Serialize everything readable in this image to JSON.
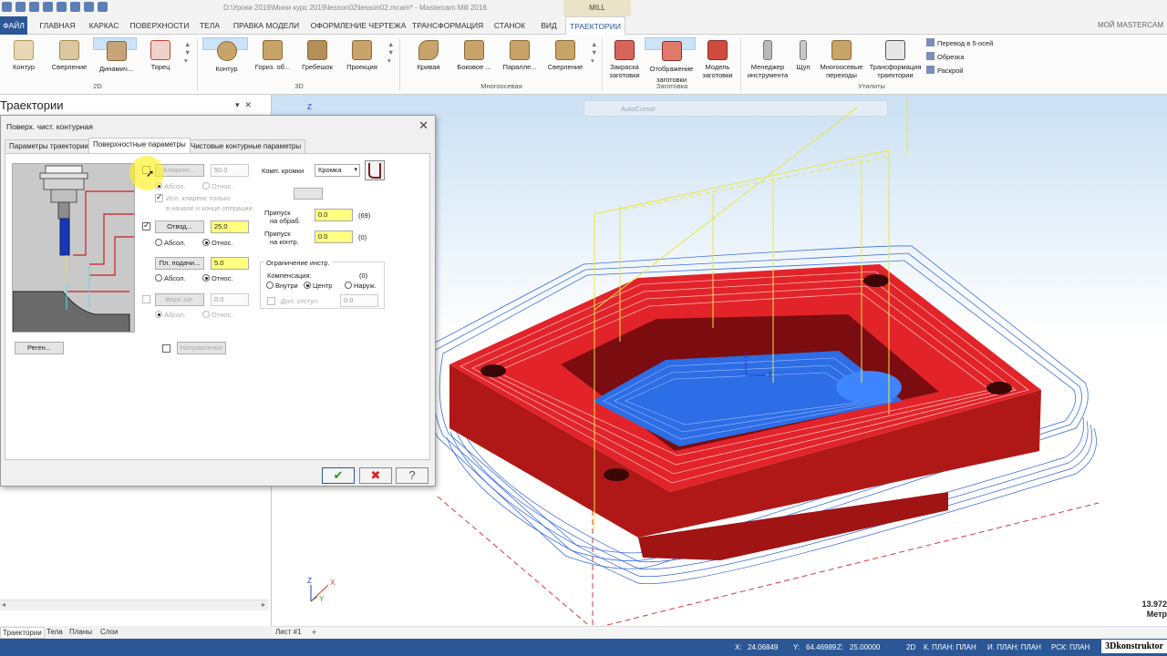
{
  "window": {
    "title": "D:\\Уроки 2019\\Мини курс 2019\\lesson02\\lesson02.mcam* - Mastercam Mill 2018",
    "context_tab": "MILL",
    "account": "МОЙ MASTERCAM"
  },
  "ribbon_tabs": [
    "ФАЙЛ",
    "ГЛАВНАЯ",
    "КАРКАС",
    "ПОВЕРХНОСТИ",
    "ТЕЛА",
    "ПРАВКА МОДЕЛИ",
    "ОФОРМЛЕНИЕ ЧЕРТЕЖА",
    "ТРАНСФОРМАЦИЯ",
    "СТАНОК",
    "ВИД",
    "ТРАЕКТОРИИ"
  ],
  "ribbon": {
    "group_2d": "2D",
    "group_3d": "3D",
    "group_multi": "Многоосевая",
    "group_stock": "Заготовка",
    "group_util": "Утилиты",
    "b2d": [
      "Контур",
      "Сверление",
      "Динамич...",
      "Торец"
    ],
    "b3d": [
      "Контур",
      "Гориз. об...",
      "Гребешок",
      "Проекция"
    ],
    "bmulti": [
      "Кривая",
      "Боковое ...",
      "Паралле...",
      "Сверление"
    ],
    "bstock": [
      "Закраска заготовки",
      "Отображение заготовки",
      "Модель заготовки"
    ],
    "butil": [
      "Менеджер инструмента",
      "Щуп",
      "Многоосевые переходы",
      "Трансформация траектории"
    ],
    "small": [
      "Перевод в 5-осей",
      "Обрезка",
      "Раскрой"
    ]
  },
  "left_panel": {
    "title": "Траектории",
    "tabs": [
      "Траектории",
      "Тела",
      "Планы",
      "Слои"
    ]
  },
  "dialog": {
    "title": "Поверх. чист. контурная",
    "tabs": [
      "Параметры траектории",
      "Поверхностные параметры",
      "Чистовые контурные параметры"
    ],
    "clearance_btn": "Клиренс...",
    "clearance_val": "50.0",
    "abs": "Абсол.",
    "rel": "Относ.",
    "use_clear": "Исп. клиренс только",
    "use_clear2": "в начале и конце операции",
    "retract_btn": "Отвод...",
    "retract_val": "25.0",
    "feed_btn": "Пл. подачи...",
    "feed_val": "5.0",
    "top_btn": "Верх заг.",
    "top_val": "0.0",
    "regen_btn": "Реген...",
    "direction_btn": "Направление",
    "edge_label": "Комп. кромки",
    "edge_val": "Кромка",
    "stock_mach_l1": "Припуск",
    "stock_mach_l2": "на обраб.",
    "stock_mach_val": "0.0",
    "stock_mach_note": "(69)",
    "stock_chk_l1": "Припуск",
    "stock_chk_l2": "на контр.",
    "stock_chk_val": "0.0",
    "stock_chk_note": "(0)",
    "tool_limit": "Ограничение инстр.",
    "compensation": "Компенсация:",
    "comp_note": "(0)",
    "inside": "Внутри",
    "center": "Центр",
    "outside": "Наруж.",
    "add_offset": "Доп. отступ",
    "add_offset_val": "0.0"
  },
  "viewport": {
    "autocursor": "AutoCursor",
    "scale_value": "13.972",
    "scale_unit": "Метр",
    "sheet_tab": "Лист #1",
    "sheet_add": "+"
  },
  "status": {
    "x_label": "X:",
    "x": "24.06849",
    "y_label": "Y:",
    "y": "64.46989",
    "z_label": "Z:",
    "z": "25.00000",
    "mode": "2D",
    "cplane": "К. ПЛАН: ПЛАН",
    "tplane": "И. ПЛАН: ПЛАН",
    "wcs": "РСК: ПЛАН",
    "watermark": "3Dkonstruktor"
  }
}
